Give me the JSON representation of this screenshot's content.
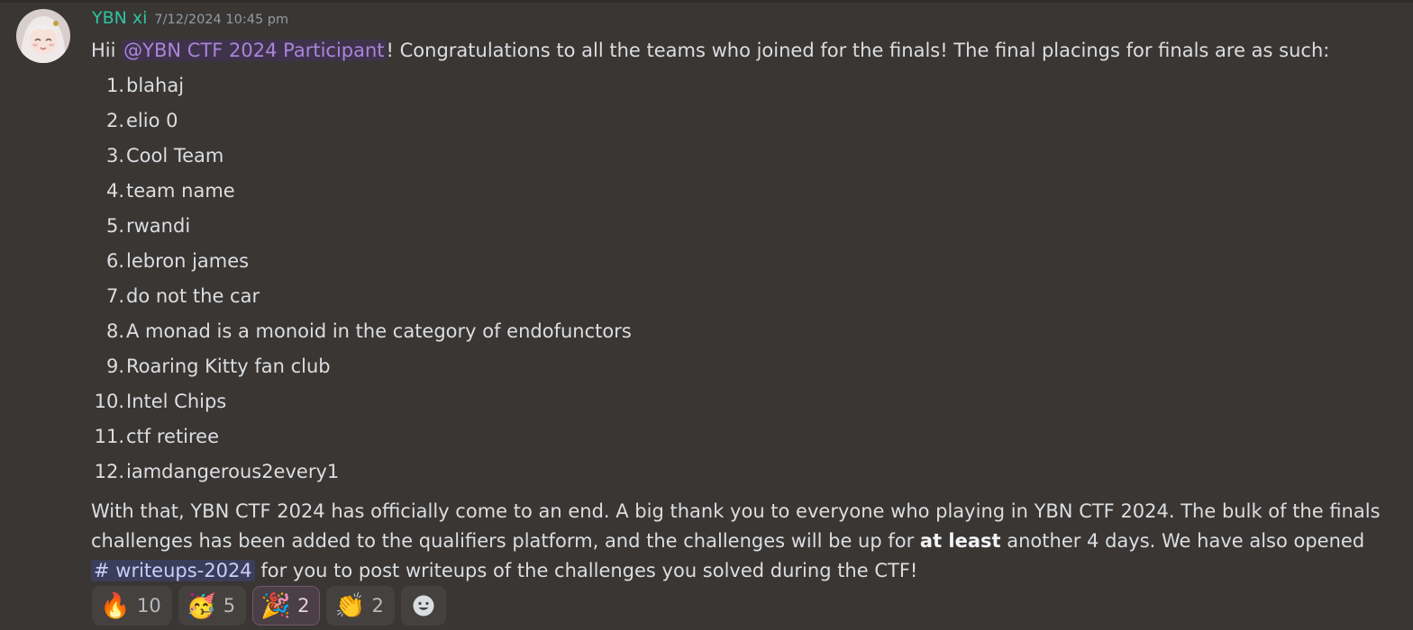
{
  "message": {
    "author": "YBN xi",
    "timestamp": "7/12/2024 10:45 pm",
    "intro_prefix": "Hii ",
    "mention": "@YBN CTF 2024 Participant",
    "intro_suffix": "! Congratulations to all the teams who joined for the finals! The final placings for finals are as such:",
    "placings": [
      {
        "rank": "1.",
        "team": "blahaj"
      },
      {
        "rank": "2.",
        "team": "elio 0"
      },
      {
        "rank": "3.",
        "team": "Cool Team"
      },
      {
        "rank": "4.",
        "team": "team name"
      },
      {
        "rank": "5.",
        "team": "rwandi"
      },
      {
        "rank": "6.",
        "team": "lebron james"
      },
      {
        "rank": "7.",
        "team": "do not the car"
      },
      {
        "rank": "8.",
        "team": "A monad is a monoid in the category of endofunctors"
      },
      {
        "rank": "9.",
        "team": "Roaring Kitty fan club"
      },
      {
        "rank": "10.",
        "team": "Intel Chips"
      },
      {
        "rank": "11.",
        "team": "ctf retiree"
      },
      {
        "rank": "12.",
        "team": "iamdangerous2every1"
      }
    ],
    "outro_part1": "With that, YBN CTF 2024 has officially come to an end. A big thank you to everyone who playing in YBN CTF 2024. The bulk of the finals challenges has been added to the qualifiers platform, and the challenges will be up for ",
    "outro_bold": "at least",
    "outro_part2": " another 4 days. We have also opened ",
    "channel": "# writeups-2024",
    "outro_part3": " for you to post writeups of the challenges you solved during the CTF!"
  },
  "reactions": [
    {
      "emoji": "🔥",
      "icon": "fire-icon",
      "count": "10",
      "me": false
    },
    {
      "emoji": "🥳",
      "icon": "partying-face-icon",
      "count": "5",
      "me": false
    },
    {
      "emoji": "🎉",
      "icon": "party-popper-icon",
      "count": "2",
      "me": true
    },
    {
      "emoji": "👏",
      "icon": "clapping-hands-icon",
      "count": "2",
      "me": false
    }
  ],
  "colors": {
    "background": "#393634",
    "username": "#2fc5a0",
    "mention_bg": "#3f334b",
    "mention_text": "#a985d9",
    "channel_bg": "#3b3e5a",
    "channel_text": "#c9cdfb"
  }
}
